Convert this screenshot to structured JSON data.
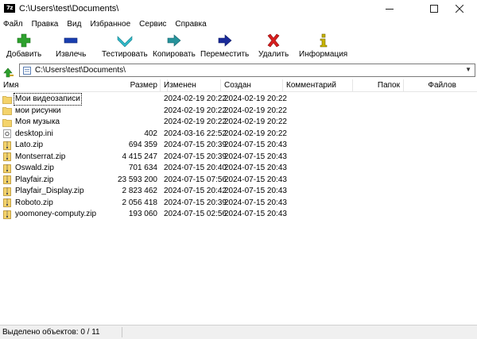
{
  "window": {
    "app_icon_text": "7z",
    "title": "C:\\Users\\test\\Documents\\",
    "controls": [
      {
        "name": "minimize-button",
        "glyph": "—"
      },
      {
        "name": "maximize-button",
        "glyph": "☐"
      },
      {
        "name": "close-button",
        "glyph": "✕"
      }
    ]
  },
  "menu": [
    "Файл",
    "Правка",
    "Вид",
    "Избранное",
    "Сервис",
    "Справка"
  ],
  "toolbar": {
    "add": {
      "label": "Добавить",
      "icon": "plus-icon",
      "color": "#2ea12e"
    },
    "extract": {
      "label": "Извлечь",
      "icon": "minus-icon",
      "color": "#1a3fb0"
    },
    "test": {
      "label": "Тестировать",
      "icon": "check-chevron-icon",
      "color": "#2fb8c8"
    },
    "copy": {
      "label": "Копировать",
      "icon": "copy-arrow-icon",
      "color": "#27939b"
    },
    "move": {
      "label": "Переместить",
      "icon": "move-arrow-icon",
      "color": "#1a2b9a"
    },
    "delete": {
      "label": "Удалить",
      "icon": "x-icon",
      "color": "#d81e1e"
    },
    "info": {
      "label": "Информация",
      "icon": "info-icon",
      "color": "#c8b400"
    }
  },
  "address": {
    "path": "C:\\Users\\test\\Documents\\"
  },
  "columns": {
    "name": "Имя",
    "size": "Размер",
    "modified": "Изменен",
    "created": "Создан",
    "comment": "Комментарий",
    "folders": "Папок",
    "files": "Файлов"
  },
  "rows": [
    {
      "type": "folder",
      "name": "Мои видеозаписи",
      "size": "",
      "modified": "2024-02-19 20:22",
      "created": "2024-02-19 20:22"
    },
    {
      "type": "folder",
      "name": "мои рисунки",
      "size": "",
      "modified": "2024-02-19 20:22",
      "created": "2024-02-19 20:22"
    },
    {
      "type": "folder",
      "name": "Моя музыка",
      "size": "",
      "modified": "2024-02-19 20:22",
      "created": "2024-02-19 20:22"
    },
    {
      "type": "ini",
      "name": "desktop.ini",
      "size": "402",
      "modified": "2024-03-16 22:52",
      "created": "2024-02-19 20:22"
    },
    {
      "type": "zip",
      "name": "Lato.zip",
      "size": "694 359",
      "modified": "2024-07-15 20:39",
      "created": "2024-07-15 20:43"
    },
    {
      "type": "zip",
      "name": "Montserrat.zip",
      "size": "4 415 247",
      "modified": "2024-07-15 20:39",
      "created": "2024-07-15 20:43"
    },
    {
      "type": "zip",
      "name": "Oswald.zip",
      "size": "701 634",
      "modified": "2024-07-15 20:40",
      "created": "2024-07-15 20:43"
    },
    {
      "type": "zip",
      "name": "Playfair.zip",
      "size": "23 593 200",
      "modified": "2024-07-15 07:56",
      "created": "2024-07-15 20:43"
    },
    {
      "type": "zip",
      "name": "Playfair_Display.zip",
      "size": "2 823 462",
      "modified": "2024-07-15 20:42",
      "created": "2024-07-15 20:43"
    },
    {
      "type": "zip",
      "name": "Roboto.zip",
      "size": "2 056 418",
      "modified": "2024-07-15 20:39",
      "created": "2024-07-15 20:43"
    },
    {
      "type": "zip",
      "name": "yoomoney-computy.zip",
      "size": "193 060",
      "modified": "2024-07-15 02:56",
      "created": "2024-07-15 20:43"
    }
  ],
  "status": {
    "selected": "Выделено объектов: 0 / 11"
  }
}
